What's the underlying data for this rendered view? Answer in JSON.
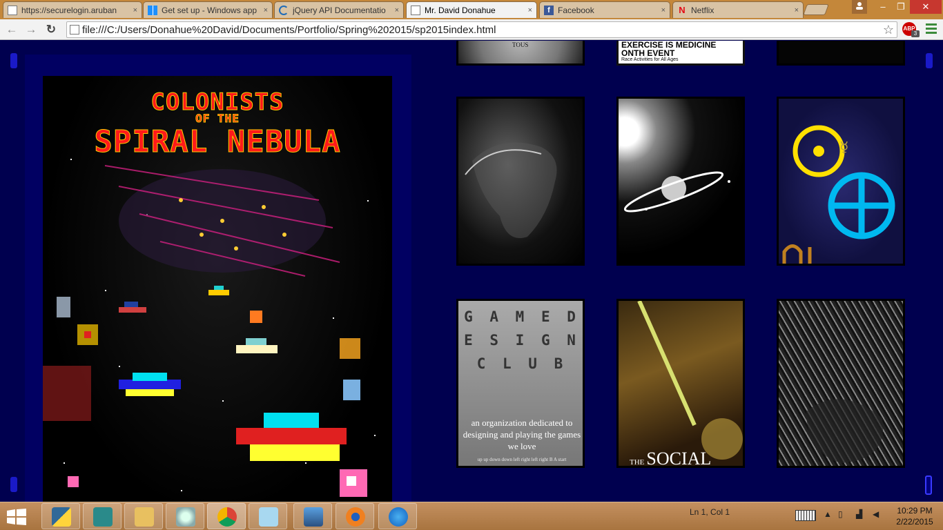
{
  "tabs": [
    {
      "title": "https://securelogin.aruban",
      "icon": "page-icon",
      "active": false
    },
    {
      "title": "Get set up - Windows app",
      "icon": "windows-icon",
      "active": false
    },
    {
      "title": "jQuery API Documentatio",
      "icon": "jquery-icon",
      "active": false
    },
    {
      "title": "Mr. David Donahue",
      "icon": "page-icon",
      "active": true
    },
    {
      "title": "Facebook",
      "icon": "facebook-icon",
      "active": false
    },
    {
      "title": "Netflix",
      "icon": "netflix-icon",
      "active": false
    }
  ],
  "tab_close_glyph": "×",
  "window_controls": {
    "minimize": "‒",
    "maximize": "❐",
    "close": "✕"
  },
  "toolbar": {
    "back": "←",
    "forward": "→",
    "reload": "↻",
    "url": "file:///C:/Users/Donahue%20David/Documents/Portfolio/Spring%202015/sp2015index.html",
    "bookmark_star": "☆",
    "adblock_label": "ABP",
    "adblock_count": "3"
  },
  "page": {
    "background": "#00004f",
    "poster": {
      "title_line1": "COLONISTS",
      "title_line2": "OF THE",
      "title_line3": "SPIRAL NEBULA"
    },
    "thumbnails": [
      {
        "name": "seal-artwork",
        "caption": "TOUS"
      },
      {
        "name": "exercise-poster",
        "caption": "EXERCISE IS MEDICINE",
        "caption2": "ONTH EVENT",
        "caption3": "Race Activities for All Ages"
      },
      {
        "name": "dark-artwork",
        "caption": ""
      },
      {
        "name": "portrait-sketch",
        "caption": ""
      },
      {
        "name": "planet-ring-artwork",
        "caption": ""
      },
      {
        "name": "symbols-space-artwork",
        "caption": ""
      },
      {
        "name": "game-design-club-poster",
        "tiles": "G A M E  D E S I G N  C L U B",
        "caption": "an organization dedicated to designing and playing the games we love",
        "footer": "up up down down left right left right B A start"
      },
      {
        "name": "the-social-poster",
        "caption_small": "THE",
        "caption_big": "SOCIAL"
      },
      {
        "name": "leaf-texture-artwork",
        "caption": ""
      }
    ]
  },
  "taskbar": {
    "start_icon": "windows-start-icon",
    "apps": [
      "python",
      "maya",
      "file-explorer",
      "network-tool",
      "chrome",
      "notepad",
      "photo-viewer",
      "blender",
      "itunes"
    ],
    "status_text": "Ln 1, Col 1",
    "time": "10:29 PM",
    "date": "2/22/2015"
  }
}
